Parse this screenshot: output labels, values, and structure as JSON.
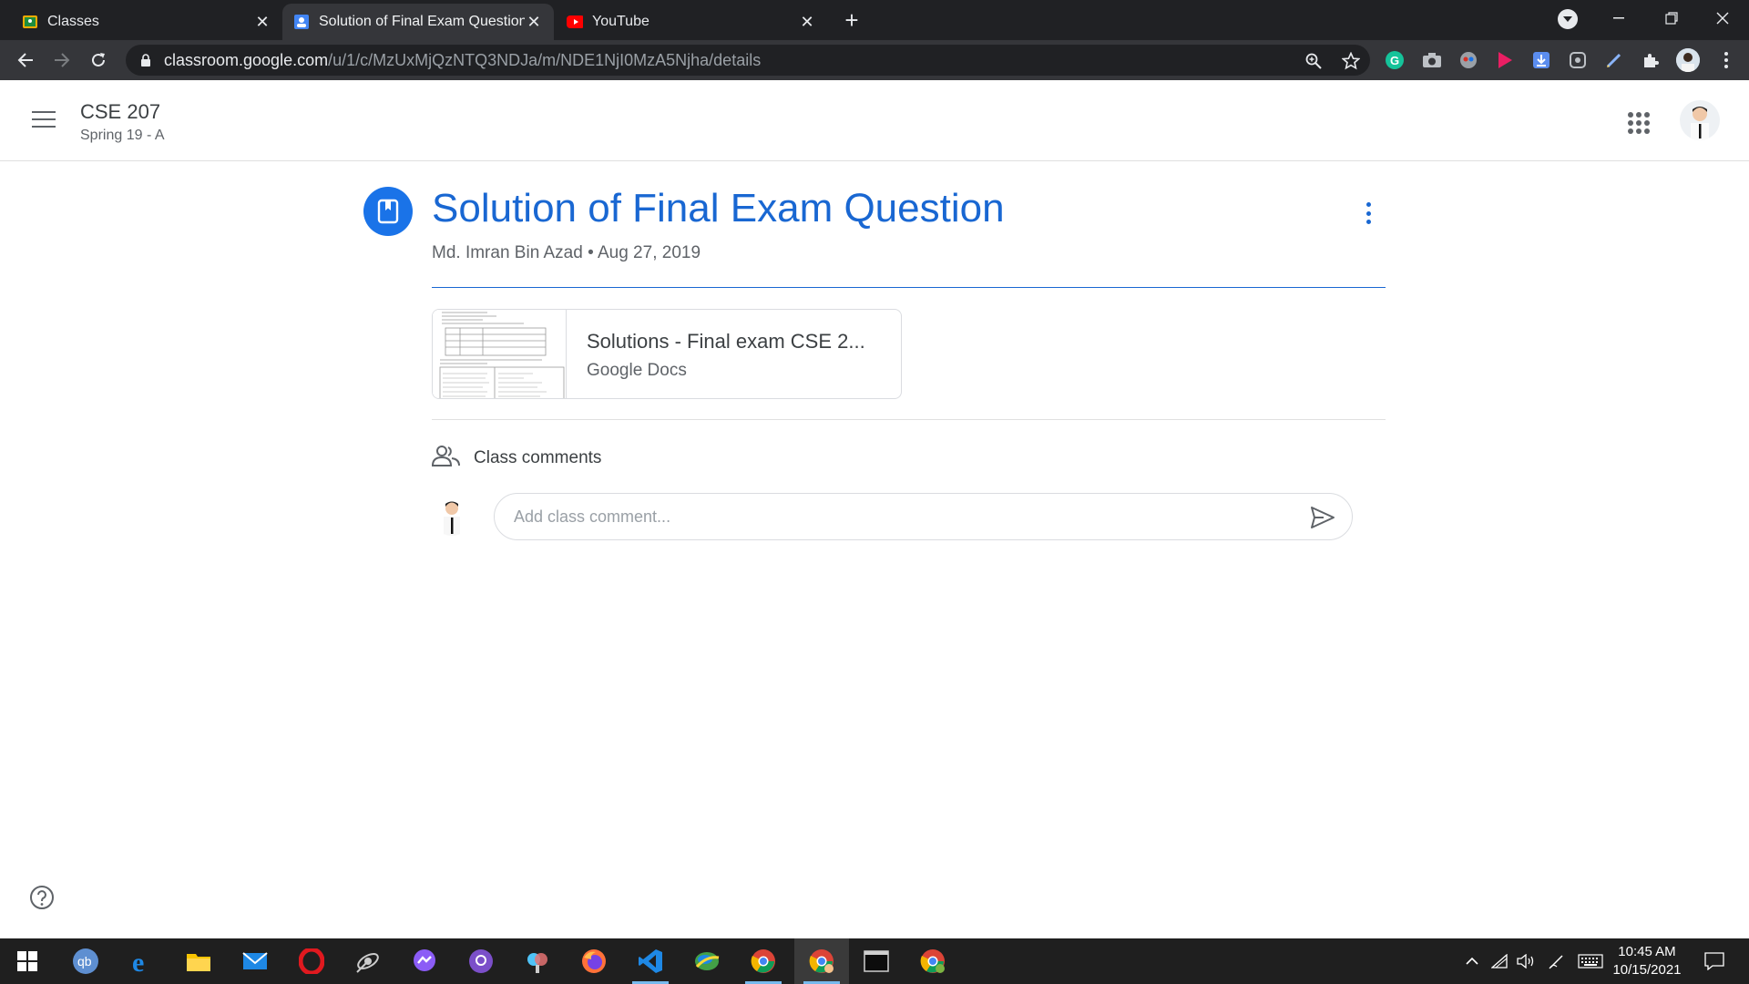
{
  "browser": {
    "tabs": [
      {
        "title": "Classes",
        "active": false
      },
      {
        "title": "Solution of Final Exam Question",
        "active": true
      },
      {
        "title": "YouTube",
        "active": false
      }
    ],
    "url_host": "classroom.google.com",
    "url_path": "/u/1/c/MzUxMjQzNTQ3NDJa/m/NDE1NjI0MzA5Njha/details",
    "extensions": [
      "grammarly-icon",
      "camera-icon",
      "extension-icon",
      "play-icon",
      "download-icon",
      "extension-icon",
      "pen-icon",
      "puzzle-icon"
    ]
  },
  "classroom": {
    "class_name": "CSE 207",
    "section": "Spring 19 - A"
  },
  "post": {
    "title": "Solution of Final Exam Question",
    "author": "Md. Imran Bin Azad",
    "separator": "•",
    "date": "Aug 27, 2019",
    "attachment": {
      "name": "Solutions - Final exam CSE 2...",
      "type": "Google Docs"
    }
  },
  "comments": {
    "label": "Class comments",
    "placeholder": "Add class comment..."
  },
  "taskbar": {
    "time": "10:45 AM",
    "date": "10/15/2021",
    "apps": [
      "start",
      "qbittorrent",
      "edge",
      "file-explorer",
      "mail",
      "opera",
      "satellite",
      "messenger",
      "github",
      "app",
      "firefox",
      "vscode",
      "app",
      "chrome",
      "chrome-active",
      "terminal",
      "chrome"
    ]
  },
  "colors": {
    "accent": "#1967d2",
    "chrome_dark": "#202124",
    "taskbar": "#1f1f1f"
  }
}
